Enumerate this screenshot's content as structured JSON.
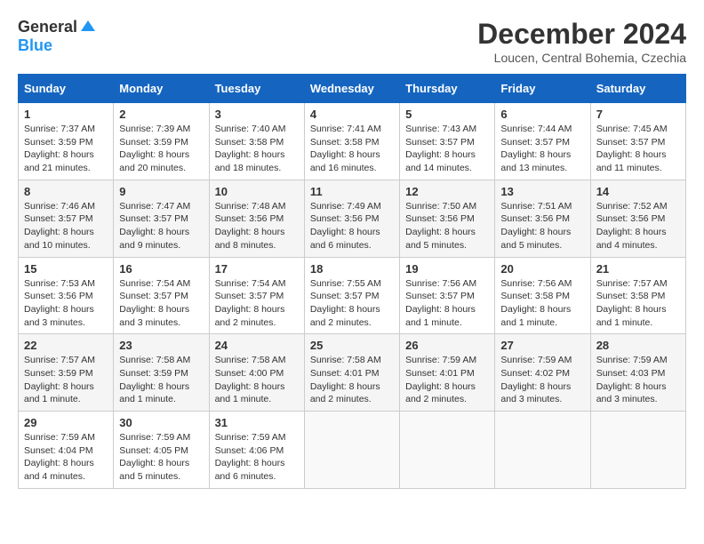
{
  "header": {
    "logo_general": "General",
    "logo_blue": "Blue",
    "month_title": "December 2024",
    "location": "Loucen, Central Bohemia, Czechia"
  },
  "days_of_week": [
    "Sunday",
    "Monday",
    "Tuesday",
    "Wednesday",
    "Thursday",
    "Friday",
    "Saturday"
  ],
  "weeks": [
    [
      {
        "day": "1",
        "sunrise": "Sunrise: 7:37 AM",
        "sunset": "Sunset: 3:59 PM",
        "daylight": "Daylight: 8 hours and 21 minutes."
      },
      {
        "day": "2",
        "sunrise": "Sunrise: 7:39 AM",
        "sunset": "Sunset: 3:59 PM",
        "daylight": "Daylight: 8 hours and 20 minutes."
      },
      {
        "day": "3",
        "sunrise": "Sunrise: 7:40 AM",
        "sunset": "Sunset: 3:58 PM",
        "daylight": "Daylight: 8 hours and 18 minutes."
      },
      {
        "day": "4",
        "sunrise": "Sunrise: 7:41 AM",
        "sunset": "Sunset: 3:58 PM",
        "daylight": "Daylight: 8 hours and 16 minutes."
      },
      {
        "day": "5",
        "sunrise": "Sunrise: 7:43 AM",
        "sunset": "Sunset: 3:57 PM",
        "daylight": "Daylight: 8 hours and 14 minutes."
      },
      {
        "day": "6",
        "sunrise": "Sunrise: 7:44 AM",
        "sunset": "Sunset: 3:57 PM",
        "daylight": "Daylight: 8 hours and 13 minutes."
      },
      {
        "day": "7",
        "sunrise": "Sunrise: 7:45 AM",
        "sunset": "Sunset: 3:57 PM",
        "daylight": "Daylight: 8 hours and 11 minutes."
      }
    ],
    [
      {
        "day": "8",
        "sunrise": "Sunrise: 7:46 AM",
        "sunset": "Sunset: 3:57 PM",
        "daylight": "Daylight: 8 hours and 10 minutes."
      },
      {
        "day": "9",
        "sunrise": "Sunrise: 7:47 AM",
        "sunset": "Sunset: 3:57 PM",
        "daylight": "Daylight: 8 hours and 9 minutes."
      },
      {
        "day": "10",
        "sunrise": "Sunrise: 7:48 AM",
        "sunset": "Sunset: 3:56 PM",
        "daylight": "Daylight: 8 hours and 8 minutes."
      },
      {
        "day": "11",
        "sunrise": "Sunrise: 7:49 AM",
        "sunset": "Sunset: 3:56 PM",
        "daylight": "Daylight: 8 hours and 6 minutes."
      },
      {
        "day": "12",
        "sunrise": "Sunrise: 7:50 AM",
        "sunset": "Sunset: 3:56 PM",
        "daylight": "Daylight: 8 hours and 5 minutes."
      },
      {
        "day": "13",
        "sunrise": "Sunrise: 7:51 AM",
        "sunset": "Sunset: 3:56 PM",
        "daylight": "Daylight: 8 hours and 5 minutes."
      },
      {
        "day": "14",
        "sunrise": "Sunrise: 7:52 AM",
        "sunset": "Sunset: 3:56 PM",
        "daylight": "Daylight: 8 hours and 4 minutes."
      }
    ],
    [
      {
        "day": "15",
        "sunrise": "Sunrise: 7:53 AM",
        "sunset": "Sunset: 3:56 PM",
        "daylight": "Daylight: 8 hours and 3 minutes."
      },
      {
        "day": "16",
        "sunrise": "Sunrise: 7:54 AM",
        "sunset": "Sunset: 3:57 PM",
        "daylight": "Daylight: 8 hours and 3 minutes."
      },
      {
        "day": "17",
        "sunrise": "Sunrise: 7:54 AM",
        "sunset": "Sunset: 3:57 PM",
        "daylight": "Daylight: 8 hours and 2 minutes."
      },
      {
        "day": "18",
        "sunrise": "Sunrise: 7:55 AM",
        "sunset": "Sunset: 3:57 PM",
        "daylight": "Daylight: 8 hours and 2 minutes."
      },
      {
        "day": "19",
        "sunrise": "Sunrise: 7:56 AM",
        "sunset": "Sunset: 3:57 PM",
        "daylight": "Daylight: 8 hours and 1 minute."
      },
      {
        "day": "20",
        "sunrise": "Sunrise: 7:56 AM",
        "sunset": "Sunset: 3:58 PM",
        "daylight": "Daylight: 8 hours and 1 minute."
      },
      {
        "day": "21",
        "sunrise": "Sunrise: 7:57 AM",
        "sunset": "Sunset: 3:58 PM",
        "daylight": "Daylight: 8 hours and 1 minute."
      }
    ],
    [
      {
        "day": "22",
        "sunrise": "Sunrise: 7:57 AM",
        "sunset": "Sunset: 3:59 PM",
        "daylight": "Daylight: 8 hours and 1 minute."
      },
      {
        "day": "23",
        "sunrise": "Sunrise: 7:58 AM",
        "sunset": "Sunset: 3:59 PM",
        "daylight": "Daylight: 8 hours and 1 minute."
      },
      {
        "day": "24",
        "sunrise": "Sunrise: 7:58 AM",
        "sunset": "Sunset: 4:00 PM",
        "daylight": "Daylight: 8 hours and 1 minute."
      },
      {
        "day": "25",
        "sunrise": "Sunrise: 7:58 AM",
        "sunset": "Sunset: 4:01 PM",
        "daylight": "Daylight: 8 hours and 2 minutes."
      },
      {
        "day": "26",
        "sunrise": "Sunrise: 7:59 AM",
        "sunset": "Sunset: 4:01 PM",
        "daylight": "Daylight: 8 hours and 2 minutes."
      },
      {
        "day": "27",
        "sunrise": "Sunrise: 7:59 AM",
        "sunset": "Sunset: 4:02 PM",
        "daylight": "Daylight: 8 hours and 3 minutes."
      },
      {
        "day": "28",
        "sunrise": "Sunrise: 7:59 AM",
        "sunset": "Sunset: 4:03 PM",
        "daylight": "Daylight: 8 hours and 3 minutes."
      }
    ],
    [
      {
        "day": "29",
        "sunrise": "Sunrise: 7:59 AM",
        "sunset": "Sunset: 4:04 PM",
        "daylight": "Daylight: 8 hours and 4 minutes."
      },
      {
        "day": "30",
        "sunrise": "Sunrise: 7:59 AM",
        "sunset": "Sunset: 4:05 PM",
        "daylight": "Daylight: 8 hours and 5 minutes."
      },
      {
        "day": "31",
        "sunrise": "Sunrise: 7:59 AM",
        "sunset": "Sunset: 4:06 PM",
        "daylight": "Daylight: 8 hours and 6 minutes."
      },
      null,
      null,
      null,
      null
    ]
  ]
}
